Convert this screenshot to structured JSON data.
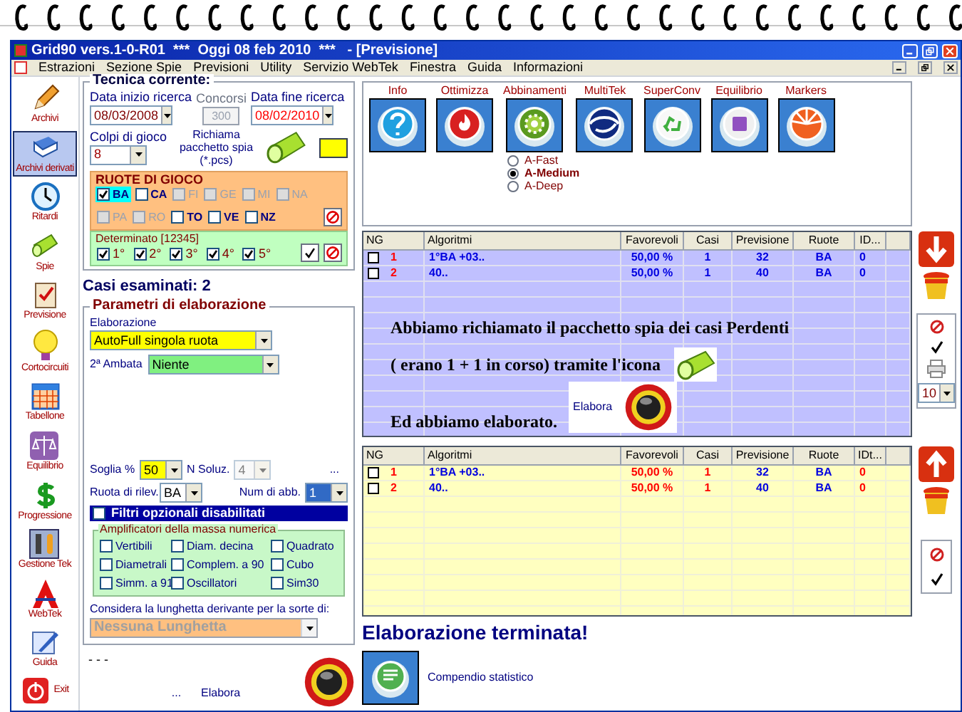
{
  "window": {
    "title": "Grid90 vers.1-0-R01  ***  Oggi 08 feb 2010  ***   - [Previsione]"
  },
  "menu": [
    "Estrazioni",
    "Sezione Spie",
    "Previsioni",
    "Utility",
    "Servizio WebTek",
    "Finestra",
    "Guida",
    "Informazioni"
  ],
  "sidebar": [
    {
      "label": "Archivi",
      "kind": "pencil",
      "selected": false
    },
    {
      "label": "Archivi derivati",
      "kind": "book",
      "selected": true
    },
    {
      "label": "Ritardi",
      "kind": "clock",
      "selected": false
    },
    {
      "label": "Spie",
      "kind": "flashlight",
      "selected": false
    },
    {
      "label": "Previsione",
      "kind": "clipboard",
      "selected": false
    },
    {
      "label": "Cortocircuiti",
      "kind": "bulb",
      "selected": false
    },
    {
      "label": "Tabellone",
      "kind": "calendar",
      "selected": false
    },
    {
      "label": "Equilibrio",
      "kind": "scales",
      "selected": false
    },
    {
      "label": "Progressione",
      "kind": "coin",
      "selected": false
    },
    {
      "label": "Gestione Tek",
      "kind": "tools",
      "selected": false
    },
    {
      "label": "WebTek",
      "kind": "logo",
      "selected": false
    },
    {
      "label": "Guida",
      "kind": "pen",
      "selected": false
    },
    {
      "label": "Exit",
      "kind": "power",
      "selected": false
    }
  ],
  "tecnica": {
    "title": "Tecnica corrente:",
    "data_inizio": {
      "label": "Data inizio ricerca",
      "value": "08/03/2008"
    },
    "concorsi": {
      "label": "Concorsi",
      "value": "300",
      "disabled": true
    },
    "data_fine": {
      "label": "Data fine ricerca",
      "value": "08/02/2010"
    },
    "colpi": {
      "label": "Colpi di gioco",
      "value": "8"
    },
    "richiama": "Richiama pacchetto spia (*.pcs)"
  },
  "ruote": {
    "title": "RUOTE DI GIOCO",
    "wheels": [
      {
        "label": "BA",
        "checked": true,
        "disabled": false,
        "selected": true
      },
      {
        "label": "CA",
        "checked": false,
        "disabled": false,
        "selected": false
      },
      {
        "label": "FI",
        "checked": false,
        "disabled": true,
        "selected": false
      },
      {
        "label": "GE",
        "checked": false,
        "disabled": true,
        "selected": false
      },
      {
        "label": "MI",
        "checked": false,
        "disabled": true,
        "selected": false
      },
      {
        "label": "NA",
        "checked": false,
        "disabled": true,
        "selected": false
      },
      {
        "label": "PA",
        "checked": false,
        "disabled": true,
        "selected": false
      },
      {
        "label": "RO",
        "checked": false,
        "disabled": true,
        "selected": false
      },
      {
        "label": "TO",
        "checked": false,
        "disabled": false,
        "selected": false
      },
      {
        "label": "VE",
        "checked": false,
        "disabled": false,
        "selected": false
      },
      {
        "label": "NZ",
        "checked": false,
        "disabled": false,
        "selected": false
      }
    ]
  },
  "determinato": {
    "title": "Determinato [12345]",
    "items": [
      {
        "label": "1°",
        "checked": true
      },
      {
        "label": "2°",
        "checked": true
      },
      {
        "label": "3°",
        "checked": true
      },
      {
        "label": "4°",
        "checked": true
      },
      {
        "label": "5°",
        "checked": true
      }
    ]
  },
  "casi": "Casi esaminati: 2",
  "parametri": {
    "title": "Parametri di elaborazione",
    "elaborazione": {
      "label": "Elaborazione",
      "value": "AutoFull singola ruota"
    },
    "ambata": {
      "label": "2ª Ambata",
      "value": "Niente"
    },
    "soglia": {
      "label": "Soglia %",
      "value": "50"
    },
    "nsoluz": {
      "label": "N Soluz.",
      "value": "4",
      "disabled": true
    },
    "more": "...",
    "ruota_rilev": {
      "label": "Ruota di rilev.",
      "value": "BA"
    },
    "num_abb": {
      "label": "Num di abb.",
      "value": "1"
    },
    "filtri": {
      "label": "Filtri opzionali disabilitati",
      "checked": false
    },
    "amplificatori": {
      "title": "Amplificatori della massa numerica",
      "items": [
        {
          "label": "Vertibili",
          "checked": false
        },
        {
          "label": "Diam. decina",
          "checked": false
        },
        {
          "label": "Quadrato",
          "checked": false
        },
        {
          "label": "Diametrali",
          "checked": false
        },
        {
          "label": "Complem. a 90",
          "checked": false
        },
        {
          "label": "Cubo",
          "checked": false
        },
        {
          "label": "Simm. a 91",
          "checked": false
        },
        {
          "label": "Oscillatori",
          "checked": false
        },
        {
          "label": "Sim30",
          "checked": false
        }
      ]
    },
    "lunghetta": {
      "label": "Considera la lunghetta derivante per la sorte di:",
      "value": "Nessuna Lunghetta",
      "disabled": true
    }
  },
  "footer": {
    "dashes": "- - -",
    "dots": "...",
    "elabora": "Elabora"
  },
  "tools": [
    {
      "label": "Info",
      "kind": "help"
    },
    {
      "label": "Ottimizza",
      "kind": "fire"
    },
    {
      "label": "Abbinamenti",
      "kind": "gear"
    },
    {
      "label": "MultiTek",
      "kind": "swirl"
    },
    {
      "label": "SuperConv",
      "kind": "recycle"
    },
    {
      "label": "Equilibrio",
      "kind": "box"
    },
    {
      "label": "Markers",
      "kind": "burst"
    }
  ],
  "algo_mode": [
    {
      "label": "A-Fast",
      "selected": false
    },
    {
      "label": "A-Medium",
      "selected": true
    },
    {
      "label": "A-Deep",
      "selected": false
    }
  ],
  "table_top": {
    "columns": [
      "NG",
      "Algoritmi",
      "Favorevoli",
      "Casi",
      "Previsione",
      "Ruote",
      "ID..."
    ],
    "rows": [
      {
        "checked": false,
        "ng": "1",
        "algoritmi": "1°BA +03..",
        "favorevoli": "50,00 %",
        "casi": "1",
        "previsione": "32",
        "ruote": "BA",
        "id": "0"
      },
      {
        "checked": false,
        "ng": "2",
        "algoritmi": "40..",
        "favorevoli": "50,00 %",
        "casi": "1",
        "previsione": "40",
        "ruote": "BA",
        "id": "0"
      }
    ],
    "note": {
      "line1": "Abbiamo richiamato il pacchetto spia dei casi Perdenti",
      "line2": "( erano 1 + 1 in corso) tramite l'icona",
      "line3": "Ed abbiamo elaborato.",
      "inset_label": "Elabora"
    }
  },
  "side_top": {
    "page_size": "10"
  },
  "table_bottom": {
    "columns": [
      "NG",
      "Algoritmi",
      "Favorevoli",
      "Casi",
      "Previsione",
      "Ruote",
      "IDt..."
    ],
    "rows": [
      {
        "checked": false,
        "ng": "1",
        "algoritmi": "1°BA +03..",
        "favorevoli": "50,00 %",
        "casi": "1",
        "previsione": "32",
        "ruote": "BA",
        "id": "0"
      },
      {
        "checked": false,
        "ng": "2",
        "algoritmi": "40..",
        "favorevoli": "50,00 %",
        "casi": "1",
        "previsione": "40",
        "ruote": "BA",
        "id": "0"
      }
    ]
  },
  "status": "Elaborazione terminata!",
  "compendio": "Compendio statistico"
}
